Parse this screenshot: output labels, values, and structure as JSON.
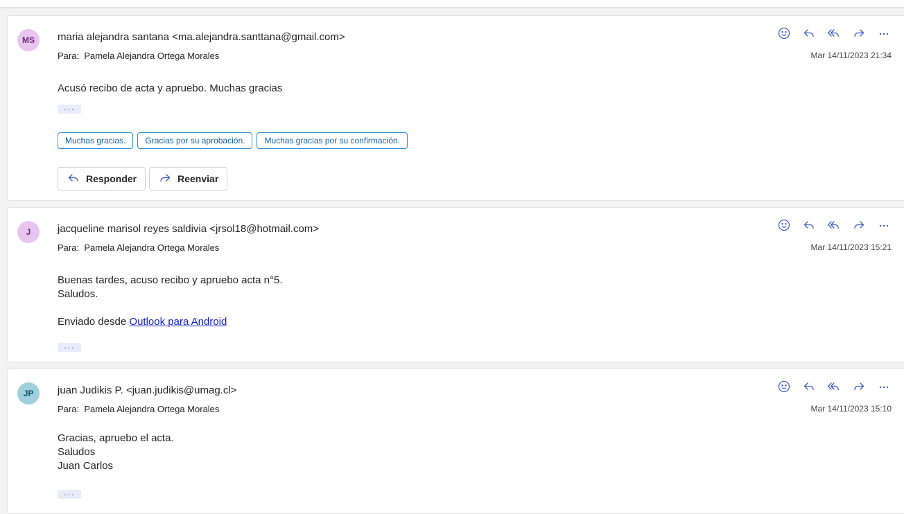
{
  "theme": {
    "accent": "#115ea3",
    "link": "#0f1ed1",
    "icon_color": "#3a5cc5"
  },
  "messages": [
    {
      "initials": "MS",
      "avatar_bg": "#e7c5ee",
      "avatar_fg": "#6b2a7a",
      "sender": "maria alejandra santana <ma.alejandra.santtana@gmail.com>",
      "to_label": "Para:",
      "to": "Pamela Alejandra Ortega Morales",
      "date": "Mar 14/11/2023 21:34",
      "body_lines": [
        "Acusó recibo de acta y apruebo. Muchas gracias"
      ],
      "more": "···",
      "suggested_replies": [
        "Muchas gracias.",
        "Gracias por su aprobación.",
        "Muchas gracias por su confirmación."
      ],
      "reply_label": "Responder",
      "forward_label": "Reenviar"
    },
    {
      "initials": "J",
      "avatar_bg": "#e7c5ee",
      "avatar_fg": "#6b2a7a",
      "sender": "jacqueline marisol reyes saldivia <jrsol18@hotmail.com>",
      "to_label": "Para:",
      "to": "Pamela Alejandra Ortega Morales",
      "date": "Mar 14/11/2023 15:21",
      "body_lines": [
        "Buenas tardes, acuso recibo y apruebo acta n°5.",
        "Saludos."
      ],
      "signature_prefix": "Enviado desde ",
      "signature_link": "Outlook para Android",
      "more": "···"
    },
    {
      "initials": "JP",
      "avatar_bg": "#9fd0dd",
      "avatar_fg": "#0e4f63",
      "sender": "juan Judikis P. <juan.judikis@umag.cl>",
      "to_label": "Para:",
      "to": "Pamela Alejandra Ortega Morales",
      "date": "Mar 14/11/2023 15:10",
      "body_lines": [
        "Gracias, apruebo el acta.",
        "Saludos",
        "Juan Carlos"
      ],
      "more": "···"
    }
  ],
  "icons": {
    "actions": [
      "emoji-icon",
      "reply-icon",
      "reply-all-icon",
      "forward-icon",
      "more-icon"
    ]
  }
}
